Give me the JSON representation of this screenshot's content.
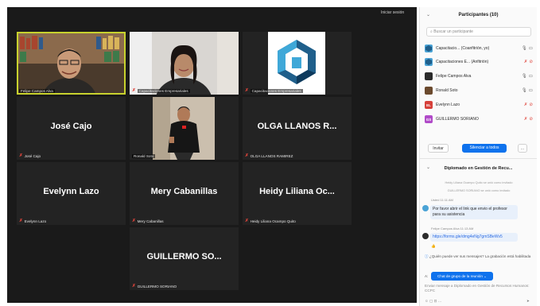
{
  "video": {
    "signin": "Iniciar sesión",
    "tiles": [
      {
        "kind": "video",
        "caption": "Felipe Campos Alva",
        "muted": false
      },
      {
        "kind": "video",
        "caption": "Capacitaciones Empresariales",
        "muted": true
      },
      {
        "kind": "logo",
        "caption": "Capacitaciones Empresariales",
        "muted": true
      },
      {
        "kind": "name",
        "name": "José Cajo",
        "caption": "José Cajo",
        "muted": true
      },
      {
        "kind": "video",
        "caption": "Ronald Soto",
        "muted": false
      },
      {
        "kind": "name",
        "name": "OLGA LLANOS R...",
        "caption": "OLGA LLANOS RAMIREZ",
        "muted": true
      },
      {
        "kind": "name",
        "name": "Evelynn Lazo",
        "caption": "Evelynn Lazo",
        "muted": true
      },
      {
        "kind": "name",
        "name": "Mery Cabanillas",
        "caption": "Mery Cabanillas",
        "muted": true
      },
      {
        "kind": "name",
        "name": "Heidy Liliana Oc...",
        "caption": "Heidy Liliana Ocampo Quito",
        "muted": true
      },
      {
        "kind": "name",
        "name": "GUILLERMO SO...",
        "caption": "GUILLERMO SORIANO",
        "muted": true
      }
    ]
  },
  "participants": {
    "title": "Participantes (10)",
    "search_placeholder": "Buscar un participante",
    "list": [
      {
        "name": "Capacitacio... (Coanfitrión, yo)",
        "initials": "",
        "color": "#4aa3d6",
        "muted": false
      },
      {
        "name": "Capacitaciones E... (Anfitrión)",
        "initials": "",
        "color": "#4aa3d6",
        "muted": true
      },
      {
        "name": "Felipe Campos Alva",
        "initials": "",
        "color": "#2b2b2b",
        "muted": false
      },
      {
        "name": "Ronald Soto",
        "initials": "",
        "color": "#6b4a2e",
        "muted": false
      },
      {
        "name": "Evelynn Lazo",
        "initials": "EL",
        "color": "#d6403a",
        "muted": true
      },
      {
        "name": "GUILLERMO SORIANO",
        "initials": "GS",
        "color": "#b04ac8",
        "muted": true
      }
    ],
    "invite": "Invitar",
    "mute_all": "Silenciar a todos",
    "more": "..."
  },
  "chat": {
    "title": "Diplomado en Gestión de Recu...",
    "sys1": "Heidy Liliana Ocampo Quito se unió como invitado",
    "sys2": "GUILLERMO SORIANO se unió como invitado",
    "msg1_meta": "Usted  11:11 AM",
    "msg1": "Por favor abrir el link que envio el profesor para su asistencia",
    "msg2_meta": "Felipe Campos Alva  11:13 AM",
    "msg2": "https://forms.gle/dmg4eNg7gmSBeWv5",
    "reactions": "👍",
    "question": "¿Quién puede ver sus mensajes? La grabación está habilitada",
    "to_label": "A:",
    "to_target": "Chat de grupo de la reunión",
    "compose": "Enviar mensaje a Diplomado en Gestión de Recursos Humanos: CCPC"
  },
  "colors": {
    "accent": "#0e72ed",
    "mute": "#e0443b",
    "active_border": "#c8d22e"
  }
}
